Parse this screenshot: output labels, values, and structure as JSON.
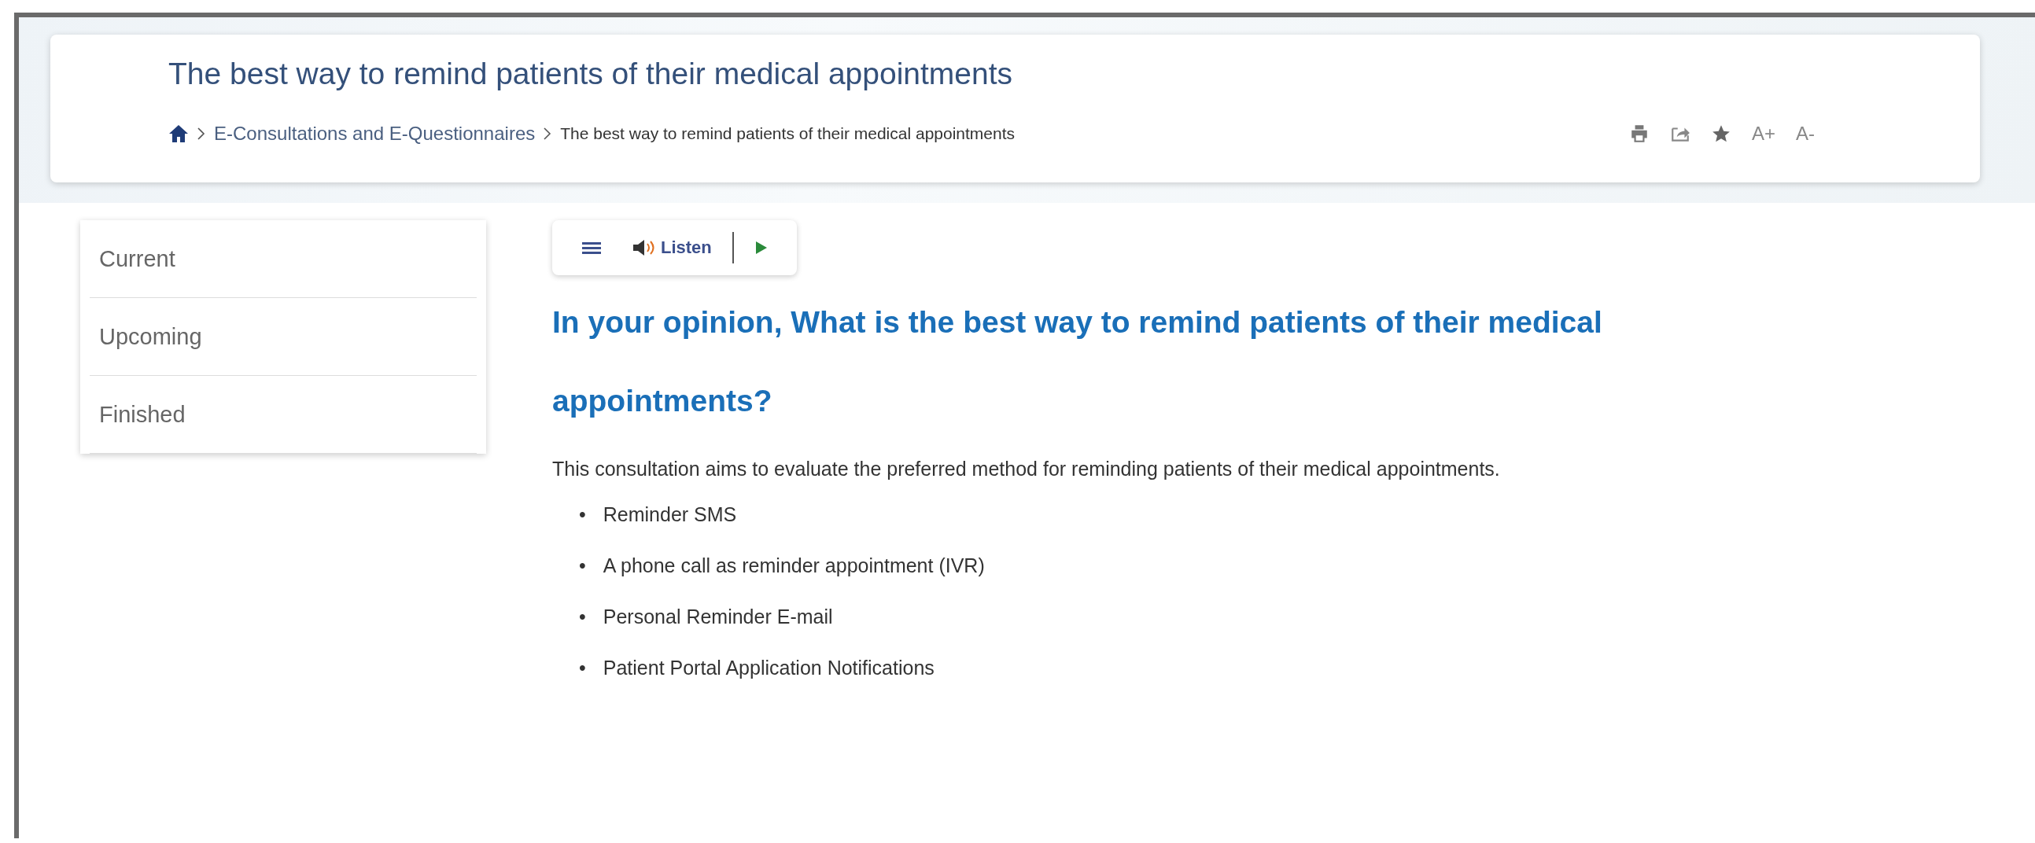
{
  "header": {
    "title": "The best way to remind patients of their medical appointments",
    "breadcrumb": [
      {
        "kind": "home"
      },
      {
        "kind": "link",
        "label": "E-Consultations and E-Questionnaires"
      },
      {
        "kind": "current",
        "label": "The best way to remind patients of their medical appointments"
      }
    ],
    "tools": [
      {
        "kind": "print"
      },
      {
        "kind": "share"
      },
      {
        "kind": "star"
      },
      {
        "kind": "text",
        "label": "A+"
      },
      {
        "kind": "text",
        "label": "A-"
      }
    ]
  },
  "sidebar": {
    "items": [
      "Current",
      "Upcoming",
      "Finished"
    ]
  },
  "player": {
    "listen_label": "Listen"
  },
  "article": {
    "heading": "In your opinion, What is the best way to remind patients of their medical appointments?",
    "intro": "This consultation aims to evaluate the preferred method for reminding patients of their medical appointments.",
    "options": [
      {
        "marker": "•",
        "label": "Reminder SMS"
      },
      {
        "marker": "•",
        "label": "A phone call as reminder appointment (IVR)"
      },
      {
        "marker": "•",
        "label": "Personal Reminder E-mail"
      },
      {
        "marker": "•",
        "label": "Patient Portal Application Notifications"
      }
    ]
  }
}
